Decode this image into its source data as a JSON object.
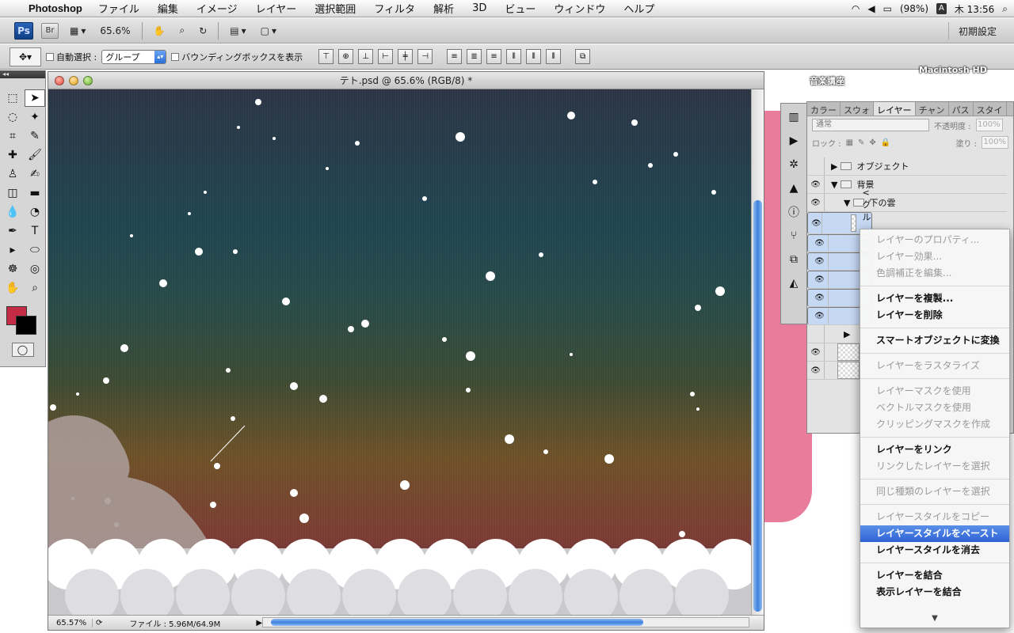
{
  "menubar": {
    "app_name": "Photoshop",
    "items": [
      "ファイル",
      "編集",
      "イメージ",
      "レイヤー",
      "選択範囲",
      "フィルタ",
      "解析",
      "3D",
      "ビュー",
      "ウィンドウ",
      "ヘルプ"
    ],
    "battery": "(98%)",
    "ime": "A",
    "clock": "木 13:56"
  },
  "appbar": {
    "ps_label": "Ps",
    "br_label": "Br",
    "zoom": "65.6%",
    "workspace": "初期設定"
  },
  "optbar": {
    "auto_select": "自動選択 :",
    "auto_select_value": "グループ",
    "bounding_box": "バウンディングボックスを表示"
  },
  "document": {
    "title": "テト.psd @ 65.6% (RGB/8) *",
    "zoom_field": "65.57%",
    "file_info": "ファイル : 5.96M/64.9M"
  },
  "desktop": {
    "label_1": "音楽講座",
    "label_2": "Macintosh HD"
  },
  "layers_panel": {
    "tabs": [
      "カラー",
      "スウォ",
      "レイヤー",
      "チャン",
      "パス",
      "スタイ"
    ],
    "active_tab": "レイヤー",
    "blend_mode": "通常",
    "opacity_label": "不透明度 :",
    "opacity_value": "100%",
    "lock_label": "ロック :",
    "fill_label": "塗り :",
    "fill_value": "100%",
    "layers": [
      {
        "name": "オブジェクト",
        "type": "folder"
      },
      {
        "name": "背景",
        "type": "folder"
      },
      {
        "name": "下の雲",
        "type": "folder"
      },
      {
        "name": "<グループ>",
        "type": "group"
      }
    ]
  },
  "context_menu": {
    "items": [
      {
        "label": "レイヤーのプロパティ...",
        "state": "disabled"
      },
      {
        "label": "レイヤー効果...",
        "state": "disabled"
      },
      {
        "label": "色調補正を編集...",
        "state": "disabled"
      },
      {
        "label": "---"
      },
      {
        "label": "レイヤーを複製...",
        "state": "enabled"
      },
      {
        "label": "レイヤーを削除",
        "state": "enabled"
      },
      {
        "label": "---"
      },
      {
        "label": "スマートオブジェクトに変換",
        "state": "enabled"
      },
      {
        "label": "---"
      },
      {
        "label": "レイヤーをラスタライズ",
        "state": "disabled"
      },
      {
        "label": "---"
      },
      {
        "label": "レイヤーマスクを使用",
        "state": "disabled"
      },
      {
        "label": "ベクトルマスクを使用",
        "state": "disabled"
      },
      {
        "label": "クリッピングマスクを作成",
        "state": "disabled"
      },
      {
        "label": "---"
      },
      {
        "label": "レイヤーをリンク",
        "state": "enabled"
      },
      {
        "label": "リンクしたレイヤーを選択",
        "state": "disabled"
      },
      {
        "label": "---"
      },
      {
        "label": "同じ種類のレイヤーを選択",
        "state": "disabled"
      },
      {
        "label": "---"
      },
      {
        "label": "レイヤースタイルをコピー",
        "state": "disabled"
      },
      {
        "label": "レイヤースタイルをペースト",
        "state": "highlight"
      },
      {
        "label": "レイヤースタイルを消去",
        "state": "enabled"
      },
      {
        "label": "---"
      },
      {
        "label": "レイヤーを結合",
        "state": "enabled"
      },
      {
        "label": "表示レイヤーを結合",
        "state": "enabled"
      }
    ]
  },
  "colors": {
    "foreground": "#c42b45",
    "background": "#000000",
    "highlight": "#2f63d6"
  }
}
